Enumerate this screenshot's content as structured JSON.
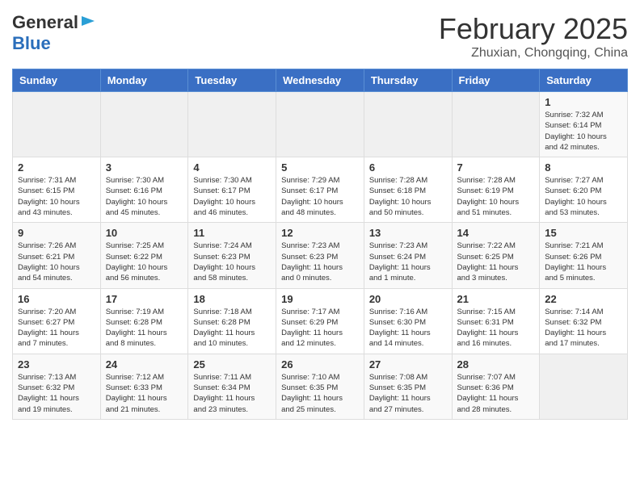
{
  "header": {
    "logo_general": "General",
    "logo_blue": "Blue",
    "title": "February 2025",
    "subtitle": "Zhuxian, Chongqing, China"
  },
  "weekdays": [
    "Sunday",
    "Monday",
    "Tuesday",
    "Wednesday",
    "Thursday",
    "Friday",
    "Saturday"
  ],
  "weeks": [
    [
      {
        "day": "",
        "info": ""
      },
      {
        "day": "",
        "info": ""
      },
      {
        "day": "",
        "info": ""
      },
      {
        "day": "",
        "info": ""
      },
      {
        "day": "",
        "info": ""
      },
      {
        "day": "",
        "info": ""
      },
      {
        "day": "1",
        "info": "Sunrise: 7:32 AM\nSunset: 6:14 PM\nDaylight: 10 hours\nand 42 minutes."
      }
    ],
    [
      {
        "day": "2",
        "info": "Sunrise: 7:31 AM\nSunset: 6:15 PM\nDaylight: 10 hours\nand 43 minutes."
      },
      {
        "day": "3",
        "info": "Sunrise: 7:30 AM\nSunset: 6:16 PM\nDaylight: 10 hours\nand 45 minutes."
      },
      {
        "day": "4",
        "info": "Sunrise: 7:30 AM\nSunset: 6:17 PM\nDaylight: 10 hours\nand 46 minutes."
      },
      {
        "day": "5",
        "info": "Sunrise: 7:29 AM\nSunset: 6:17 PM\nDaylight: 10 hours\nand 48 minutes."
      },
      {
        "day": "6",
        "info": "Sunrise: 7:28 AM\nSunset: 6:18 PM\nDaylight: 10 hours\nand 50 minutes."
      },
      {
        "day": "7",
        "info": "Sunrise: 7:28 AM\nSunset: 6:19 PM\nDaylight: 10 hours\nand 51 minutes."
      },
      {
        "day": "8",
        "info": "Sunrise: 7:27 AM\nSunset: 6:20 PM\nDaylight: 10 hours\nand 53 minutes."
      }
    ],
    [
      {
        "day": "9",
        "info": "Sunrise: 7:26 AM\nSunset: 6:21 PM\nDaylight: 10 hours\nand 54 minutes."
      },
      {
        "day": "10",
        "info": "Sunrise: 7:25 AM\nSunset: 6:22 PM\nDaylight: 10 hours\nand 56 minutes."
      },
      {
        "day": "11",
        "info": "Sunrise: 7:24 AM\nSunset: 6:23 PM\nDaylight: 10 hours\nand 58 minutes."
      },
      {
        "day": "12",
        "info": "Sunrise: 7:23 AM\nSunset: 6:23 PM\nDaylight: 11 hours\nand 0 minutes."
      },
      {
        "day": "13",
        "info": "Sunrise: 7:23 AM\nSunset: 6:24 PM\nDaylight: 11 hours\nand 1 minute."
      },
      {
        "day": "14",
        "info": "Sunrise: 7:22 AM\nSunset: 6:25 PM\nDaylight: 11 hours\nand 3 minutes."
      },
      {
        "day": "15",
        "info": "Sunrise: 7:21 AM\nSunset: 6:26 PM\nDaylight: 11 hours\nand 5 minutes."
      }
    ],
    [
      {
        "day": "16",
        "info": "Sunrise: 7:20 AM\nSunset: 6:27 PM\nDaylight: 11 hours\nand 7 minutes."
      },
      {
        "day": "17",
        "info": "Sunrise: 7:19 AM\nSunset: 6:28 PM\nDaylight: 11 hours\nand 8 minutes."
      },
      {
        "day": "18",
        "info": "Sunrise: 7:18 AM\nSunset: 6:28 PM\nDaylight: 11 hours\nand 10 minutes."
      },
      {
        "day": "19",
        "info": "Sunrise: 7:17 AM\nSunset: 6:29 PM\nDaylight: 11 hours\nand 12 minutes."
      },
      {
        "day": "20",
        "info": "Sunrise: 7:16 AM\nSunset: 6:30 PM\nDaylight: 11 hours\nand 14 minutes."
      },
      {
        "day": "21",
        "info": "Sunrise: 7:15 AM\nSunset: 6:31 PM\nDaylight: 11 hours\nand 16 minutes."
      },
      {
        "day": "22",
        "info": "Sunrise: 7:14 AM\nSunset: 6:32 PM\nDaylight: 11 hours\nand 17 minutes."
      }
    ],
    [
      {
        "day": "23",
        "info": "Sunrise: 7:13 AM\nSunset: 6:32 PM\nDaylight: 11 hours\nand 19 minutes."
      },
      {
        "day": "24",
        "info": "Sunrise: 7:12 AM\nSunset: 6:33 PM\nDaylight: 11 hours\nand 21 minutes."
      },
      {
        "day": "25",
        "info": "Sunrise: 7:11 AM\nSunset: 6:34 PM\nDaylight: 11 hours\nand 23 minutes."
      },
      {
        "day": "26",
        "info": "Sunrise: 7:10 AM\nSunset: 6:35 PM\nDaylight: 11 hours\nand 25 minutes."
      },
      {
        "day": "27",
        "info": "Sunrise: 7:08 AM\nSunset: 6:35 PM\nDaylight: 11 hours\nand 27 minutes."
      },
      {
        "day": "28",
        "info": "Sunrise: 7:07 AM\nSunset: 6:36 PM\nDaylight: 11 hours\nand 28 minutes."
      },
      {
        "day": "",
        "info": ""
      }
    ]
  ]
}
